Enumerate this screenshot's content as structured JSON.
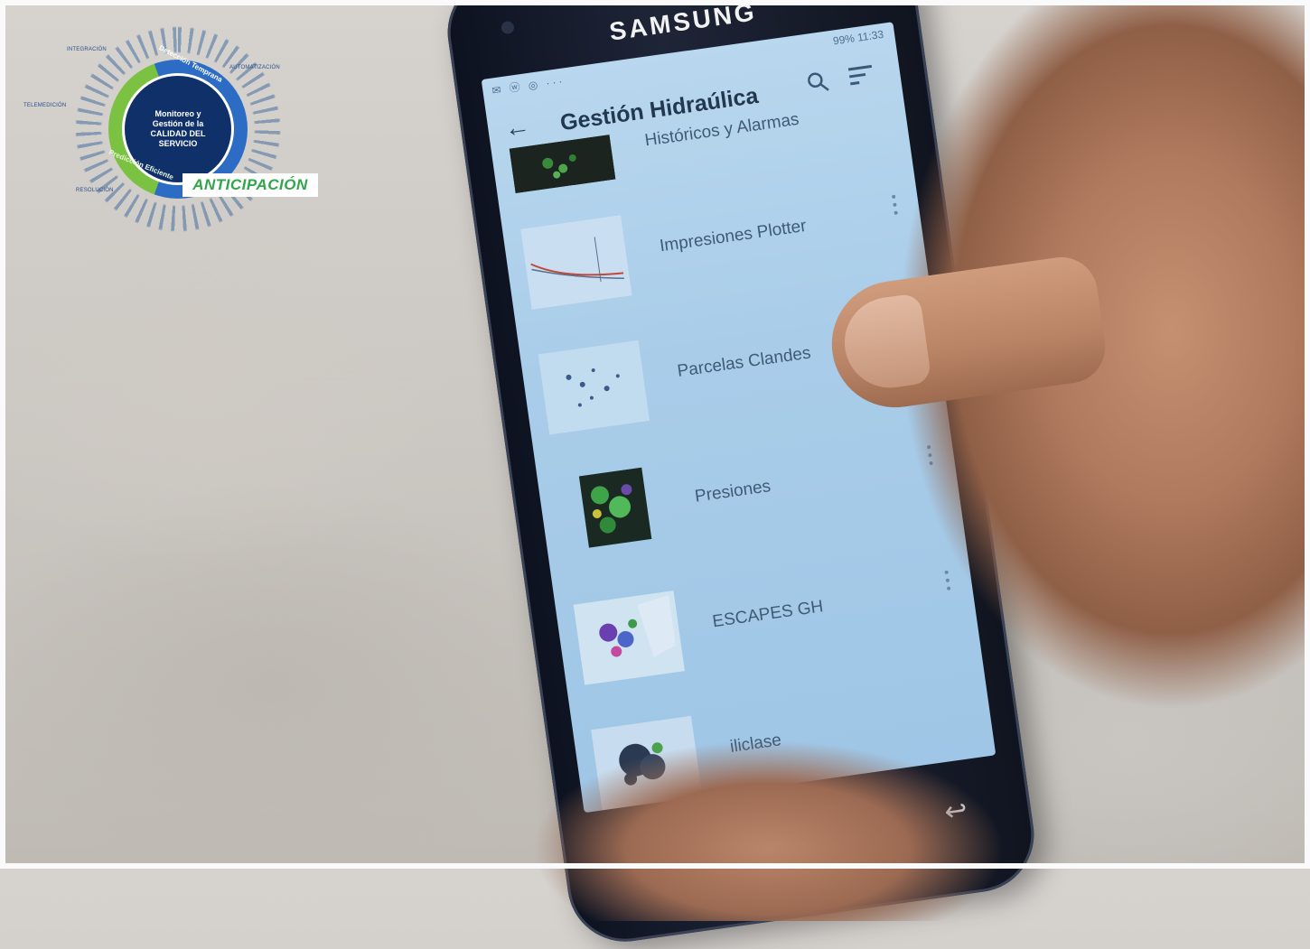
{
  "badge": {
    "center_text": "Monitoreo y Gestión de la CALIDAD DEL SERVICIO",
    "arc_top": "Detección Temprana",
    "arc_bottom": "Predicción Eficiente",
    "tags": [
      "INTEGRACIÓN",
      "AUTOMATIZACIÓN",
      "TELEMEDICIÓN",
      "RESOLUCIÓN"
    ],
    "highlight": "ANTICIPACIÓN",
    "colors": {
      "blue": "#2c6cc4",
      "green": "#7cc242",
      "navy": "#10306a",
      "highlight_text": "#2fa64a"
    }
  },
  "phone": {
    "brand": "SAMSUNG",
    "status": {
      "left_icons": "✉ ⓦ ◎ ···",
      "right_text": "99% 11:33"
    },
    "appbar": {
      "title": "Gestión Hidraúlica",
      "back_icon": "arrow-left",
      "search_icon": "search",
      "filter_icon": "filter-lines"
    },
    "items": [
      {
        "label": "Históricos y Alarmas",
        "thumb": "dark-green-map"
      },
      {
        "label": "Impresiones Plotter",
        "thumb": "line-plot"
      },
      {
        "label": "Parcelas Clandes",
        "thumb": "dot-map"
      },
      {
        "label": "Presiones",
        "thumb": "green-heat-map"
      },
      {
        "label": "ESCAPES GH",
        "thumb": "purple-map"
      },
      {
        "label": "iliclase",
        "thumb": "dark-blue-map"
      }
    ],
    "screen_color": "#a9cde9"
  }
}
